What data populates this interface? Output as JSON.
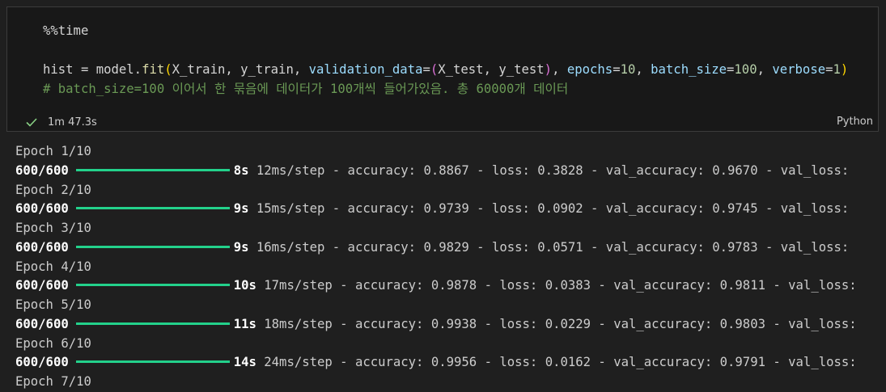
{
  "cell": {
    "code_lines": [
      [
        {
          "t": "%%time",
          "c": ""
        }
      ],
      [
        {
          "t": "",
          "c": ""
        }
      ],
      [
        {
          "t": "hist = model.",
          "c": ""
        },
        {
          "t": "fit",
          "c": "call"
        },
        {
          "t": "(",
          "c": "p1"
        },
        {
          "t": "X_train, y_train, ",
          "c": ""
        },
        {
          "t": "validation_data",
          "c": "var"
        },
        {
          "t": "=",
          "c": ""
        },
        {
          "t": "(",
          "c": "p2"
        },
        {
          "t": "X_test, y_test",
          "c": ""
        },
        {
          "t": ")",
          "c": "p2"
        },
        {
          "t": ", ",
          "c": ""
        },
        {
          "t": "epochs",
          "c": "var"
        },
        {
          "t": "=",
          "c": ""
        },
        {
          "t": "10",
          "c": "num"
        },
        {
          "t": ", ",
          "c": ""
        },
        {
          "t": "batch_size",
          "c": "var"
        },
        {
          "t": "=",
          "c": ""
        },
        {
          "t": "100",
          "c": "num"
        },
        {
          "t": ", ",
          "c": ""
        },
        {
          "t": "verbose",
          "c": "var"
        },
        {
          "t": "=",
          "c": ""
        },
        {
          "t": "1",
          "c": "num"
        },
        {
          "t": ")",
          "c": "p1"
        }
      ],
      [
        {
          "t": "# batch_size=100 이어서 한 묶음에 데이터가 100개씩 들어가있음. 총 60000개 데이터",
          "c": "comment"
        }
      ]
    ],
    "exec_time": "1m 47.3s",
    "language": "Python"
  },
  "output": {
    "epochs": [
      {
        "label": "Epoch 1/10",
        "steps": "600/600",
        "time": "8s",
        "per_step": "12ms/step",
        "accuracy": "0.8867",
        "loss": "0.3828",
        "val_accuracy": "0.9670",
        "progress": 1.0
      },
      {
        "label": "Epoch 2/10",
        "steps": "600/600",
        "time": "9s",
        "per_step": "15ms/step",
        "accuracy": "0.9739",
        "loss": "0.0902",
        "val_accuracy": "0.9745",
        "progress": 1.0
      },
      {
        "label": "Epoch 3/10",
        "steps": "600/600",
        "time": "9s",
        "per_step": "16ms/step",
        "accuracy": "0.9829",
        "loss": "0.0571",
        "val_accuracy": "0.9783",
        "progress": 1.0
      },
      {
        "label": "Epoch 4/10",
        "steps": "600/600",
        "time": "10s",
        "per_step": "17ms/step",
        "accuracy": "0.9878",
        "loss": "0.0383",
        "val_accuracy": "0.9811",
        "progress": 1.0
      },
      {
        "label": "Epoch 5/10",
        "steps": "600/600",
        "time": "11s",
        "per_step": "18ms/step",
        "accuracy": "0.9938",
        "loss": "0.0229",
        "val_accuracy": "0.9803",
        "progress": 1.0
      },
      {
        "label": "Epoch 6/10",
        "steps": "600/600",
        "time": "14s",
        "per_step": "24ms/step",
        "accuracy": "0.9956",
        "loss": "0.0162",
        "val_accuracy": "0.9791",
        "progress": 1.0
      }
    ],
    "trailing_label": "Epoch 7/10"
  },
  "colors": {
    "background": "#1f1f1f",
    "cell_background": "#181818",
    "progress_bar": "#23d18b",
    "success_check": "#89d185",
    "comment": "#6a9955"
  },
  "icons": {
    "status": "check-icon"
  }
}
